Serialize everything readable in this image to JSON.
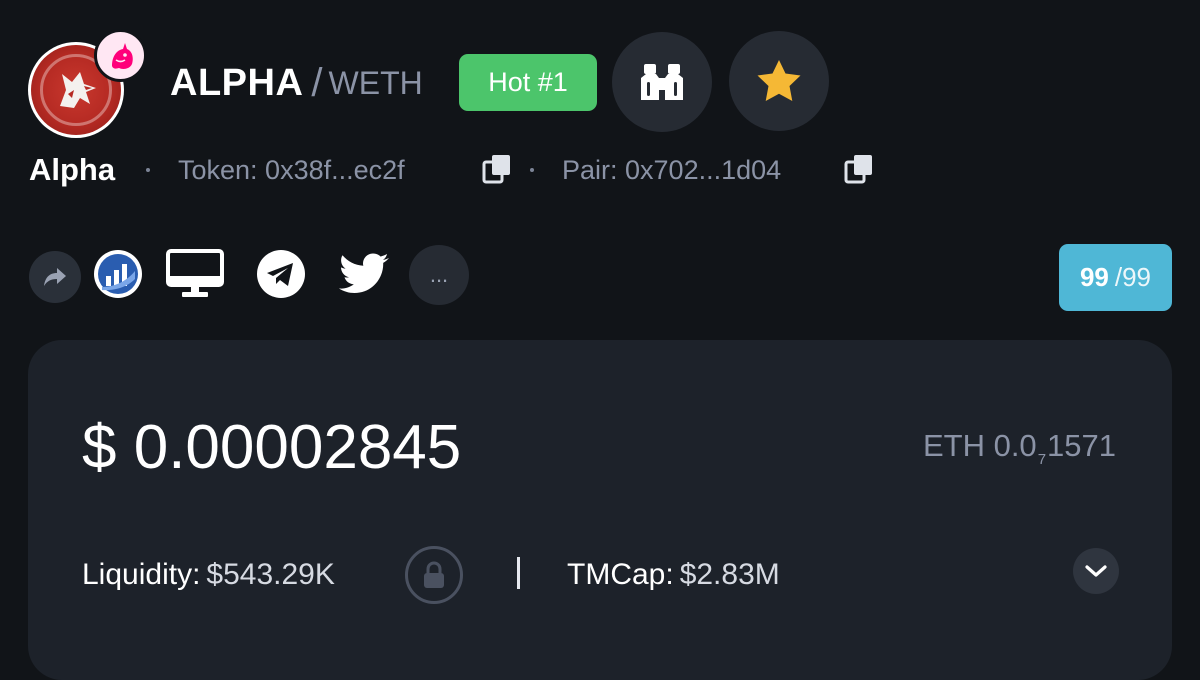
{
  "header": {
    "base_symbol": "ALPHA",
    "separator": "/",
    "quote_symbol": "WETH",
    "hot_badge": "Hot #1",
    "logo_icon": "wolf-icon",
    "dex_icon": "uniswap-unicorn-icon",
    "watch_icon": "binoculars-icon",
    "favorite_icon": "star-icon"
  },
  "subheader": {
    "token_name": "Alpha",
    "token_address": "Token: 0x38f...ec2f",
    "pair_address": "Pair: 0x702...1d04",
    "copy_icon": "copy-icon"
  },
  "socials": {
    "items": [
      "share-icon",
      "chart-site-icon",
      "website-icon",
      "telegram-icon",
      "twitter-icon"
    ],
    "more_label": "..."
  },
  "score": {
    "value": "99",
    "max": "/99"
  },
  "price_card": {
    "usd_price": "$ 0.00002845",
    "eth_prefix": "ETH 0.0",
    "eth_zero_count": "7",
    "eth_digits": "1571",
    "liquidity_label": "Liquidity:",
    "liquidity_value": "$543.29K",
    "tmcap_label": "TMCap:",
    "tmcap_value": "$2.83M",
    "lock_icon": "lock-icon",
    "expand_icon": "chevron-down-icon"
  },
  "colors": {
    "background": "#111418",
    "card": "#1d222a",
    "hot_badge": "#4cc56b",
    "score_badge": "#4fb7d6",
    "star": "#f5b835",
    "muted_text": "#8b93a6"
  }
}
